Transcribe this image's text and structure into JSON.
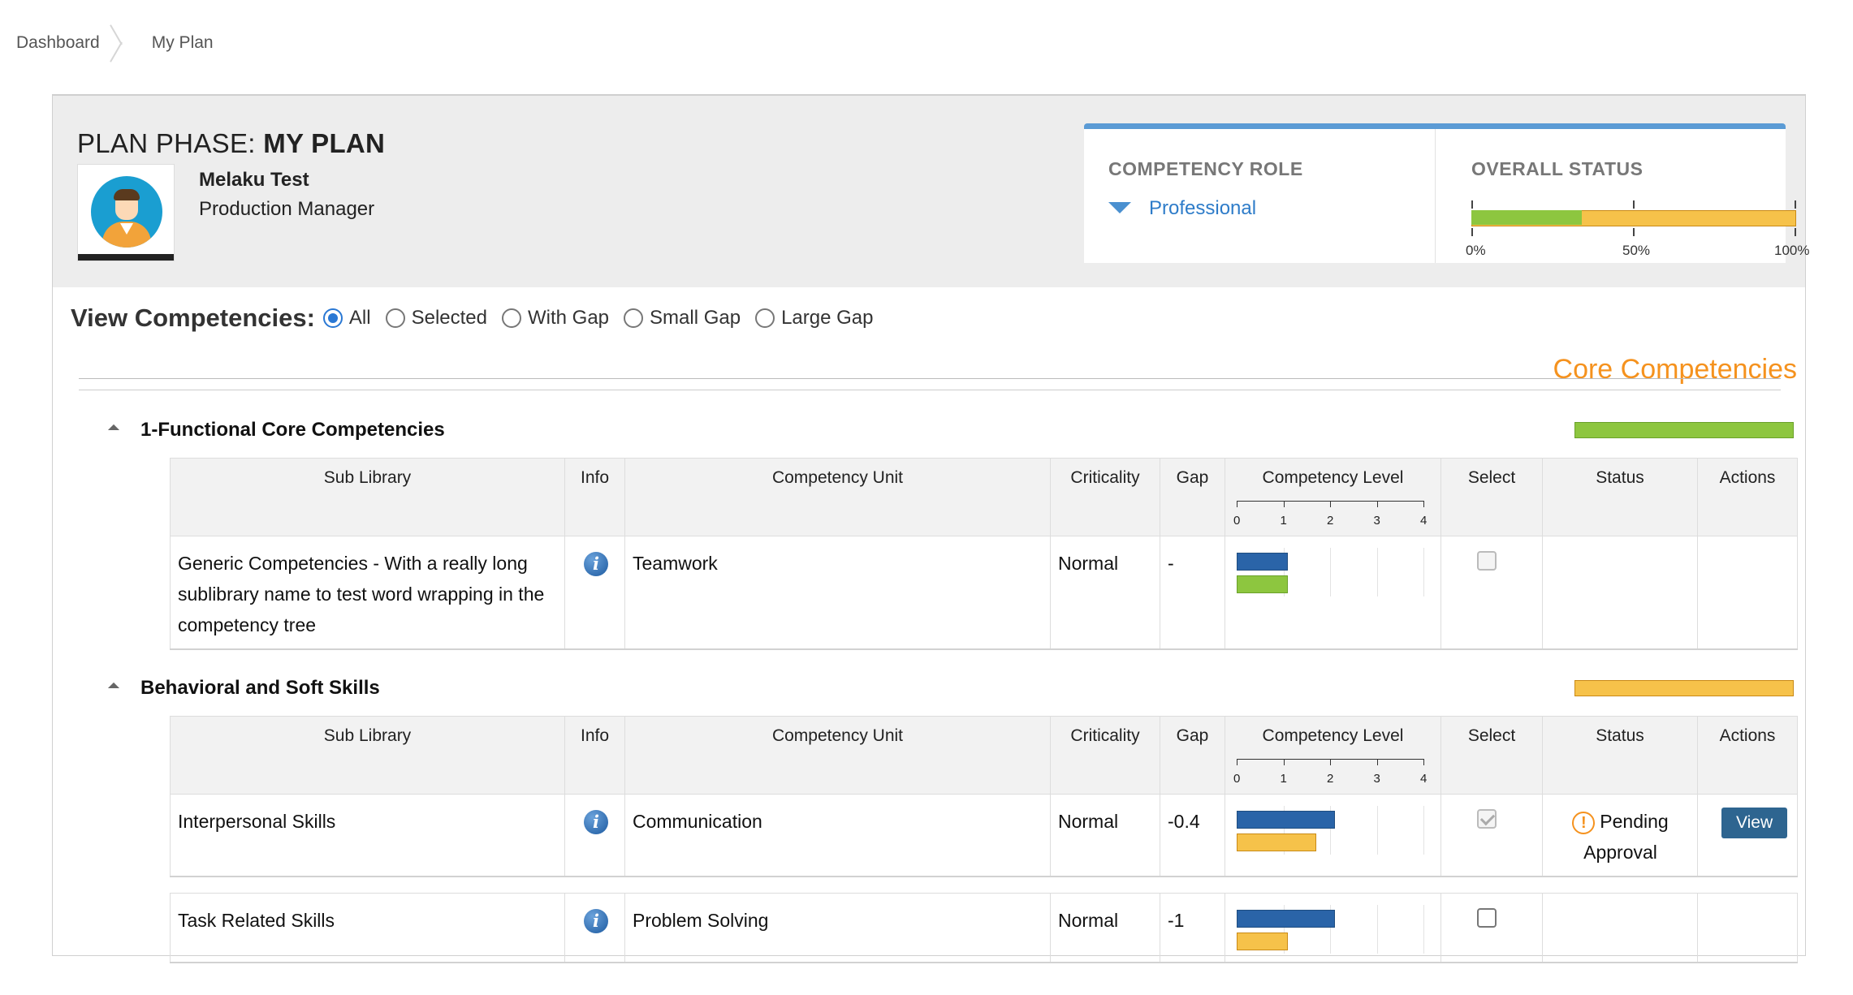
{
  "breadcrumb": {
    "items": [
      "Dashboard",
      "My Plan"
    ]
  },
  "header": {
    "plan_phase_label": "PLAN PHASE:",
    "plan_phase_value": "MY PLAN",
    "user_name": "Melaku Test",
    "user_role": "Production Manager",
    "avatar_icon": "user-avatar-icon"
  },
  "role_card": {
    "role_label": "COMPETENCY ROLE",
    "role_value": "Professional",
    "status_label": "OVERALL STATUS",
    "overall_progress": 0.34,
    "ticks": [
      "0%",
      "50%",
      "100%"
    ]
  },
  "filters": {
    "label": "View Competencies:",
    "options": [
      "All",
      "Selected",
      "With Gap",
      "Small Gap",
      "Large Gap"
    ],
    "selected": "All"
  },
  "core_title": "Core Competencies",
  "columns": [
    "Sub Library",
    "Info",
    "Competency Unit",
    "Criticality",
    "Gap",
    "Competency Level",
    "Select",
    "Status",
    "Actions"
  ],
  "level_scale": [
    "0",
    "1",
    "2",
    "3",
    "4"
  ],
  "colors": {
    "accent": "#5b9bd5",
    "orange": "#f5921e",
    "green": "#8dc63f",
    "yellow": "#f6c24a",
    "blue_bar": "#2a64a8"
  },
  "sections": [
    {
      "title": "1-Functional Core Competencies",
      "status_color": "green",
      "rows": [
        {
          "sub_library": "Generic Competencies - With a really long sublibrary name to test word wrapping in the competency tree",
          "unit": "Teamwork",
          "criticality": "Normal",
          "gap": "-",
          "current_level": 1.1,
          "required_level": 1.1,
          "select": "unchecked-disabled",
          "status": "",
          "action": ""
        }
      ]
    },
    {
      "title": "Behavioral and Soft Skills",
      "status_color": "orange",
      "rows": [
        {
          "sub_library": "Interpersonal Skills",
          "unit": "Communication",
          "criticality": "Normal",
          "gap": "-0.4",
          "current_level": 2.1,
          "required_level": 1.7,
          "select": "checked-disabled",
          "status": "Pending Approval",
          "action": "View"
        },
        {
          "sub_library": "Task Related Skills",
          "unit": "Problem Solving",
          "criticality": "Normal",
          "gap": "-1",
          "current_level": 2.1,
          "required_level": 1.1,
          "select": "unchecked",
          "status": "",
          "action": ""
        }
      ]
    }
  ]
}
